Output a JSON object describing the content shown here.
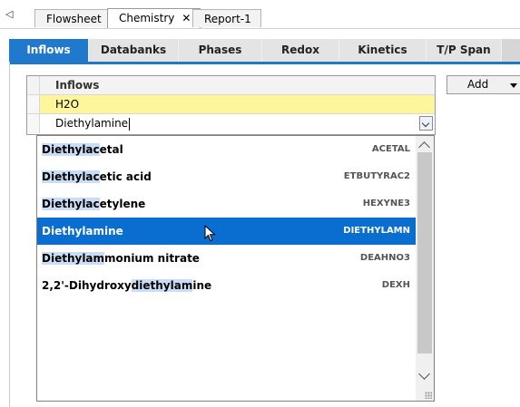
{
  "doc_tabs": {
    "scroll_glyph": "◁",
    "items": [
      {
        "label": "Flowsheet",
        "active": false
      },
      {
        "label": "Chemistry",
        "active": true,
        "close": "✕"
      },
      {
        "label": "Report-1",
        "active": false
      }
    ]
  },
  "sub_tabs": [
    "Inflows",
    "Databanks",
    "Phases",
    "Redox",
    "Kinetics",
    "T/P Span"
  ],
  "grid": {
    "header": "Inflows",
    "rows": [
      "H2O"
    ],
    "edit_value": "Diethylamine"
  },
  "dropdown": {
    "items": [
      {
        "match": "Diethylac",
        "rest": "etal",
        "code": "ACETAL"
      },
      {
        "match": "Diethylac",
        "rest": "etic acid",
        "code": "ETBUTYRAC2"
      },
      {
        "match": "Diethylac",
        "rest": "etylene",
        "code": "HEXYNE3"
      },
      {
        "match": "",
        "rest": "Diethylamine",
        "code": "DIETHYLAMN",
        "selected": true
      },
      {
        "match": "Diethylam",
        "rest": "monium nitrate",
        "code": "DEAHNO3"
      },
      {
        "prefix": "2,2'-Dihydroxy",
        "match": "diethylam",
        "rest": "ine",
        "code": "DEXH"
      }
    ]
  },
  "add_button": "Add",
  "colors": {
    "accent": "#2079cc",
    "selection": "#0a6ed1",
    "highlight_row": "#fff59b",
    "match": "#c9ddf7"
  }
}
